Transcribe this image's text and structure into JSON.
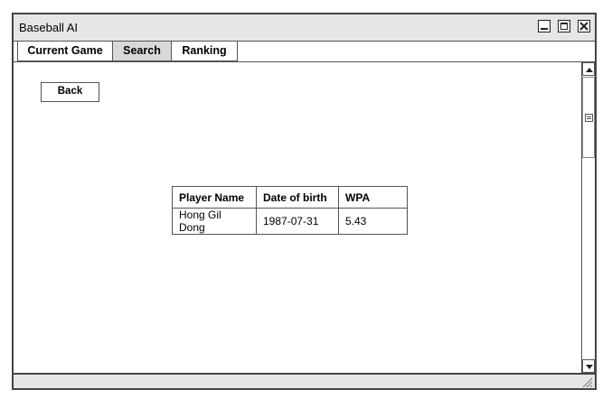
{
  "window": {
    "title": "Baseball AI"
  },
  "tabs": [
    {
      "label": "Current Game"
    },
    {
      "label": "Search"
    },
    {
      "label": "Ranking"
    }
  ],
  "active_tab": "Search",
  "back_label": "Back",
  "table": {
    "headers": [
      "Player Name",
      "Date of birth",
      "WPA"
    ],
    "rows": [
      [
        "Hong Gil Dong",
        "1987-07-31",
        "5.43"
      ]
    ]
  }
}
